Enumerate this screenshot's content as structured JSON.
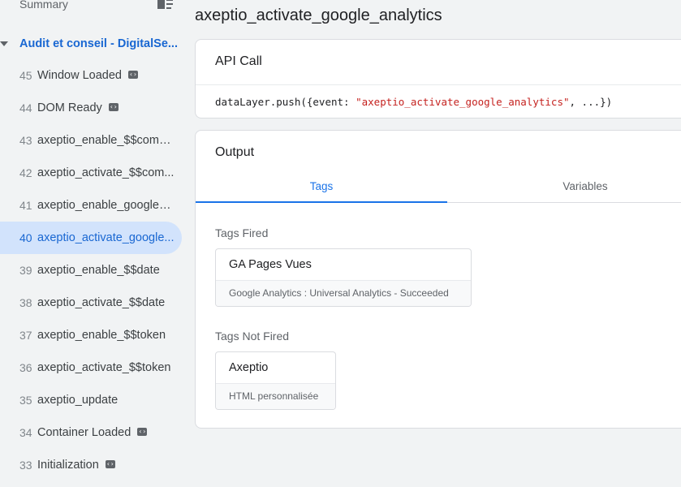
{
  "sidebar": {
    "summary_label": "Summary",
    "container_name": "Audit et conseil - DigitalSe...",
    "events": [
      {
        "num": "45",
        "name": "Window Loaded",
        "code_icon": true
      },
      {
        "num": "44",
        "name": "DOM Ready",
        "code_icon": true
      },
      {
        "num": "43",
        "name": "axeptio_enable_$$comp...",
        "code_icon": false
      },
      {
        "num": "42",
        "name": "axeptio_activate_$$com...",
        "code_icon": false
      },
      {
        "num": "41",
        "name": "axeptio_enable_google_...",
        "code_icon": false
      },
      {
        "num": "40",
        "name": "axeptio_activate_google...",
        "code_icon": false,
        "selected": true
      },
      {
        "num": "39",
        "name": "axeptio_enable_$$date",
        "code_icon": false
      },
      {
        "num": "38",
        "name": "axeptio_activate_$$date",
        "code_icon": false
      },
      {
        "num": "37",
        "name": "axeptio_enable_$$token",
        "code_icon": false
      },
      {
        "num": "36",
        "name": "axeptio_activate_$$token",
        "code_icon": false
      },
      {
        "num": "35",
        "name": "axeptio_update",
        "code_icon": false
      },
      {
        "num": "34",
        "name": "Container Loaded",
        "code_icon": true
      },
      {
        "num": "33",
        "name": "Initialization",
        "code_icon": true
      }
    ]
  },
  "main": {
    "title": "axeptio_activate_google_analytics",
    "api_call": {
      "title": "API Call",
      "code_prefix": "dataLayer.push({event: ",
      "code_string": "\"axeptio_activate_google_analytics\"",
      "code_suffix": ", ...})"
    },
    "output": {
      "title": "Output",
      "tabs": [
        "Tags",
        "Variables"
      ],
      "active_tab": "Tags",
      "fired_label": "Tags Fired",
      "fired_tags": [
        {
          "name": "GA Pages Vues",
          "subtitle": "Google Analytics : Universal Analytics - Succeeded"
        }
      ],
      "not_fired_label": "Tags Not Fired",
      "not_fired_tags": [
        {
          "name": "Axeptio",
          "subtitle": "HTML personnalisée"
        }
      ]
    }
  },
  "colors": {
    "accent": "#1a73e8",
    "selected_bg": "#d2e3fc",
    "code_string": "#c5221f",
    "background": "#f1f3f4"
  },
  "icons": {
    "summary": "summary-list-icon",
    "caret": "caret-down-icon",
    "code": "code-brackets-icon"
  }
}
